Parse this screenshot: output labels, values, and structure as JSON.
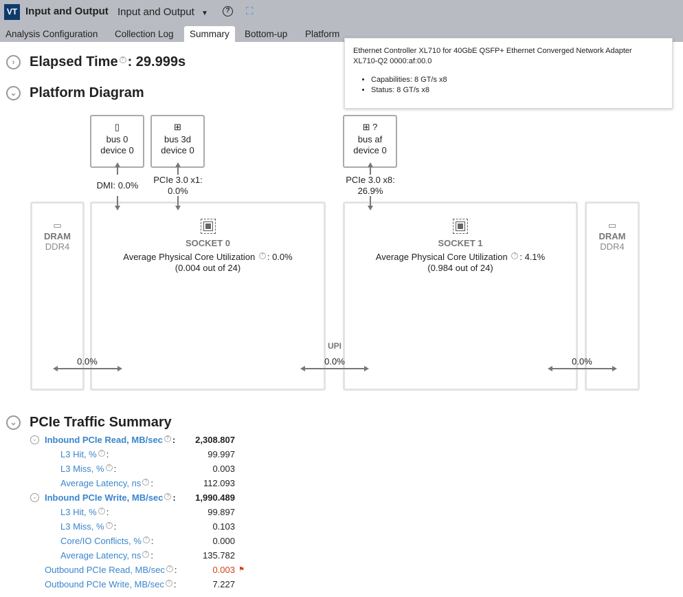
{
  "header": {
    "logo": "VT",
    "title": "Input and Output",
    "analysis_select": "Input and Output",
    "help": "?"
  },
  "tabs": [
    "Analysis Configuration",
    "Collection Log",
    "Summary",
    "Bottom-up",
    "Platform"
  ],
  "active_tab": "Summary",
  "elapsed": {
    "label": "Elapsed Time",
    "value": ": 29.999s"
  },
  "platform": {
    "title": "Platform Diagram",
    "devices": [
      {
        "bus": "bus 0",
        "device": "device 0",
        "link": "DMI: 0.0%",
        "icon": "dmi-chip-icon"
      },
      {
        "bus": "bus 3d",
        "device": "device 0",
        "link": "PCIe 3.0 x1:",
        "link2": "0.0%",
        "icon": "network-icon"
      },
      {
        "bus": "bus af",
        "device": "device 0",
        "link": "PCIe 3.0 x8:",
        "link2": "26.9%",
        "icon": "network-icon"
      }
    ],
    "dram": [
      {
        "title": "DRAM",
        "type": "DDR4",
        "bw": "0.0%"
      },
      {
        "title": "DRAM",
        "type": "DDR4",
        "bw": "0.0%"
      }
    ],
    "sockets": [
      {
        "title": "SOCKET 0",
        "util_label": "Average Physical Core Utilization",
        "util": ": 0.0%",
        "detail": "(0.004 out of 24)"
      },
      {
        "title": "SOCKET 1",
        "util_label": "Average Physical Core Utilization",
        "util": ": 4.1%",
        "detail": "(0.984 out of 24)"
      }
    ],
    "upi": {
      "label": "UPI",
      "value": "0.0%"
    }
  },
  "tooltip": {
    "line1": "Ethernet Controller XL710 for 40GbE QSFP+ Ethernet Converged Network Adapter",
    "line2": "XL710-Q2 0000:af:00.0",
    "items": [
      "Capabilities: 8 GT/s x8",
      "Status: 8 GT/s x8"
    ]
  },
  "pcie": {
    "title": "PCIe Traffic Summary",
    "rows": [
      {
        "label": "Inbound PCIe Read, MB/sec",
        "value": "2,308.807",
        "level": 1,
        "bold": true,
        "expand": true
      },
      {
        "label": "L3 Hit, %",
        "value": "99.997",
        "level": 2
      },
      {
        "label": "L3 Miss, %",
        "value": "0.003",
        "level": 2
      },
      {
        "label": "Average Latency, ns",
        "value": "112.093",
        "level": 2
      },
      {
        "label": "Inbound PCIe Write, MB/sec",
        "value": "1,990.489",
        "level": 1,
        "bold": true,
        "expand": true
      },
      {
        "label": "L3 Hit, %",
        "value": "99.897",
        "level": 2
      },
      {
        "label": "L3 Miss, %",
        "value": "0.103",
        "level": 2
      },
      {
        "label": "Core/IO Conflicts, %",
        "value": "0.000",
        "level": 2
      },
      {
        "label": "Average Latency, ns",
        "value": "135.782",
        "level": 2
      },
      {
        "label": "Outbound PCIe Read, MB/sec",
        "value": "0.003",
        "level": 1,
        "flag": true
      },
      {
        "label": "Outbound PCIe Write, MB/sec",
        "value": "7.227",
        "level": 1
      }
    ],
    "flag_color": "#d4401a",
    "link_color": "#3a85cc"
  }
}
